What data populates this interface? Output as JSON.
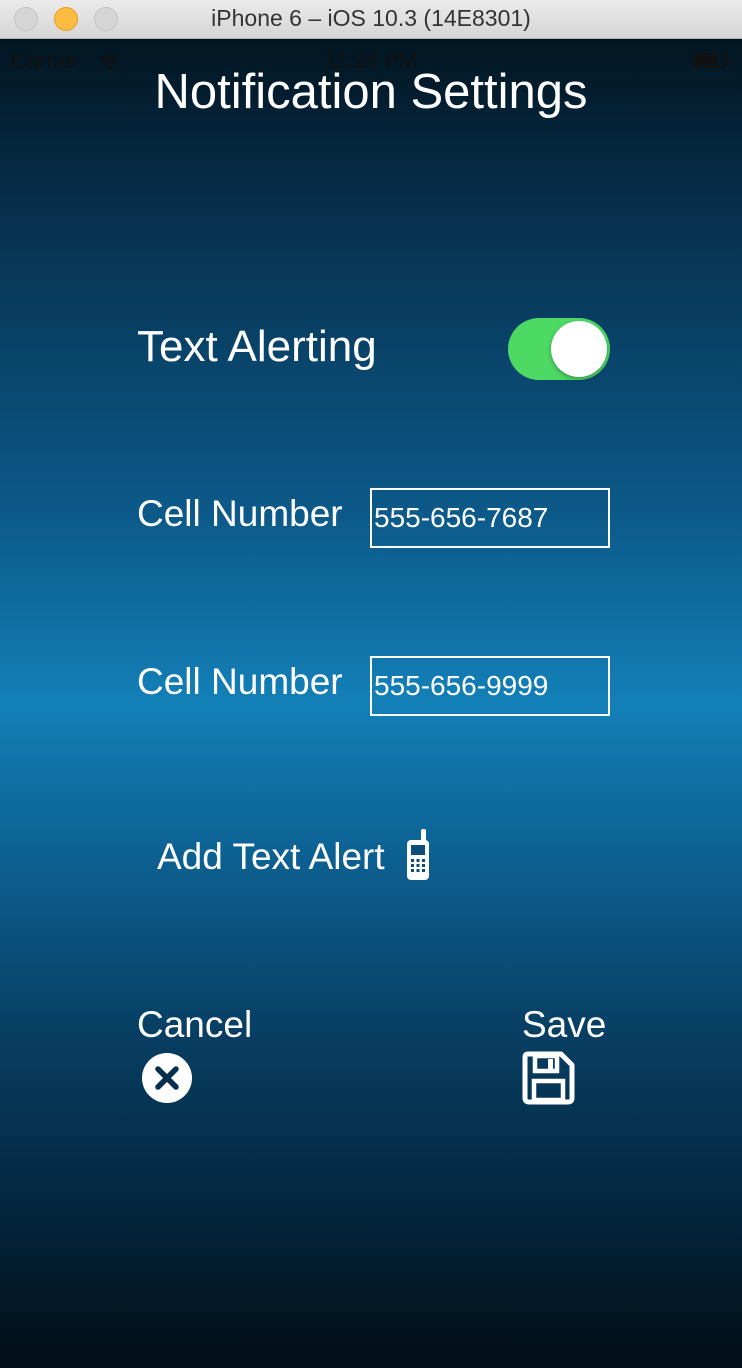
{
  "window": {
    "title": "iPhone 6 – iOS 10.3 (14E8301)"
  },
  "status_bar": {
    "carrier": "Carrier",
    "time": "11:24 PM"
  },
  "page": {
    "title": "Notification Settings"
  },
  "text_alerting": {
    "label": "Text Alerting",
    "enabled": true
  },
  "cell_numbers": [
    {
      "label": "Cell Number",
      "value": "555-656-7687"
    },
    {
      "label": "Cell Number",
      "value": "555-656-9999"
    }
  ],
  "add_text_alert": {
    "label": "Add Text Alert",
    "icon": "mobile-phone-icon"
  },
  "actions": {
    "cancel_label": "Cancel",
    "cancel_icon": "close-circle-icon",
    "save_label": "Save",
    "save_icon": "floppy-disk-icon"
  },
  "colors": {
    "toggle_on": "#4cd964",
    "text": "#ffffff",
    "background_top": "#021521",
    "background_mid": "#1380b8"
  }
}
